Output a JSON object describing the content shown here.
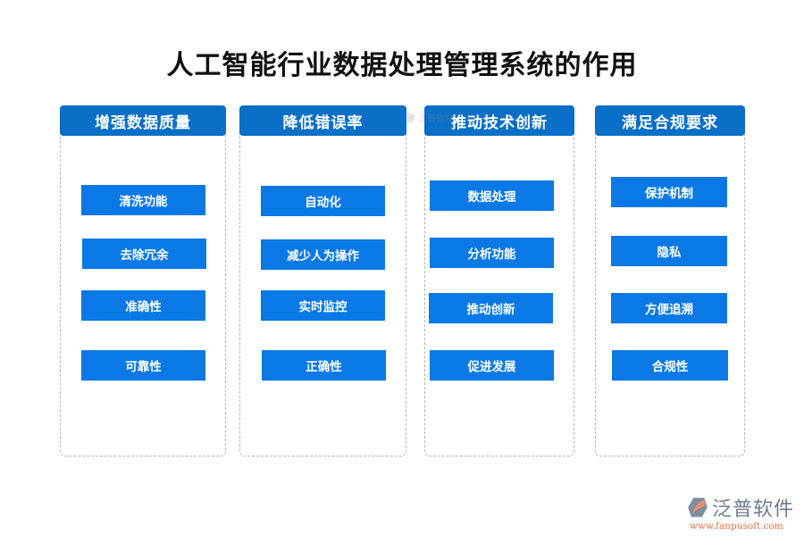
{
  "title": "人工智能行业数据处理管理系统的作用",
  "colors": {
    "header_bg": "#0a6fc6",
    "item_bg": "#0a79e6",
    "border": "#a9b4c6",
    "logo_orange": "#e0704a",
    "logo_gray": "#6c7c92"
  },
  "columns": [
    {
      "header": "增强数据质量",
      "items": [
        "清洗功能",
        "去除冗余",
        "准确性",
        "可靠性"
      ]
    },
    {
      "header": "降低错误率",
      "items": [
        "自动化",
        "减少人为操作",
        "实时监控",
        "正确性"
      ]
    },
    {
      "header": "推动技术创新",
      "items": [
        "数据处理",
        "分析功能",
        "推动创新",
        "促进发展"
      ]
    },
    {
      "header": "满足合规要求",
      "items": [
        "保护机制",
        "隐私",
        "方便追溯",
        "合规性"
      ]
    }
  ],
  "watermark": {
    "text": "泛普软件",
    "icon": "fanpu-logo-icon"
  },
  "brand": {
    "name": "泛普软件",
    "url": "www.fanpusoft.com",
    "icon": "fanpu-logo-icon"
  }
}
